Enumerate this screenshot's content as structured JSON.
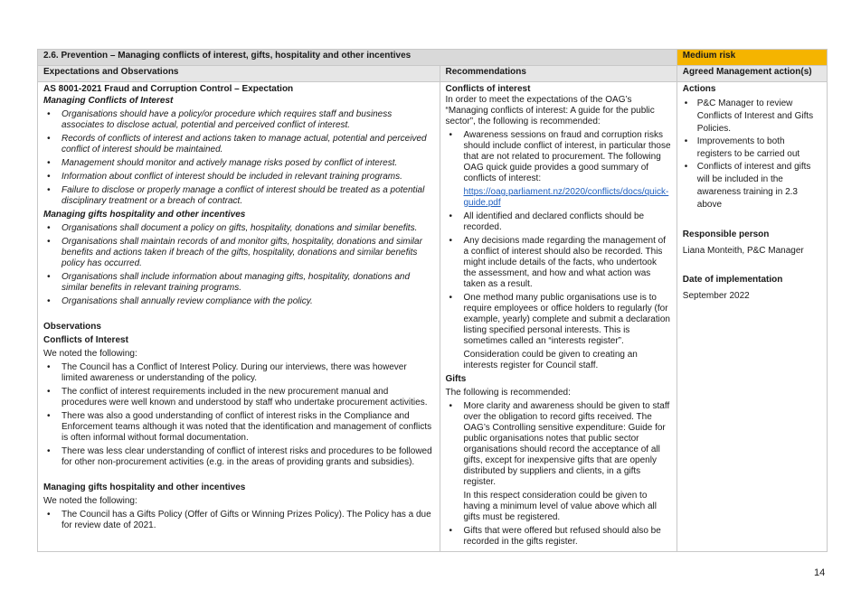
{
  "header": {
    "title": "2.6. Prevention – Managing conflicts of interest, gifts, hospitality and other incentives",
    "risk": "Medium risk",
    "col1": "Expectations and Observations",
    "col2": "Recommendations",
    "col3": "Agreed Management action(s)"
  },
  "col1": {
    "expectation_title": "AS 8001-2021 Fraud and Corruption Control – Expectation",
    "coi_heading": "Managing Conflicts of Interest",
    "coi_items": [
      "Organisations should have a policy/or procedure which requires staff and business associates to disclose actual, potential and perceived conflict of interest.",
      "Records of conflicts of interest and actions taken to manage actual, potential and perceived conflict of interest should be maintained.",
      "Management should monitor and actively manage risks posed by conflict of interest.",
      "Information about conflict of interest should be included in relevant training programs.",
      "Failure to disclose or properly manage a conflict of interest should be treated as a potential disciplinary treatment or a breach of contract."
    ],
    "gifts_heading": "Managing gifts hospitality and other incentives",
    "gifts_items": [
      "Organisations shall document a policy on gifts, hospitality, donations and similar benefits.",
      "Organisations shall maintain records of and monitor gifts, hospitality, donations and similar benefits and actions taken if breach of the gifts, hospitality, donations and similar benefits policy has occurred.",
      "Organisations shall include information about managing gifts, hospitality, donations and similar benefits in relevant training programs.",
      "Organisations shall annually review compliance with the policy."
    ],
    "observations_title": "Observations",
    "obs_coi_title": "Conflicts of Interest",
    "obs_coi_intro": "We noted the following:",
    "obs_coi_items": [
      "The Council has a Conflict of Interest Policy. During our interviews, there was however limited awareness or understanding of the policy.",
      "The conflict of interest requirements included in the new procurement manual and procedures were well known and understood by staff who undertake procurement activities.",
      "There was also a good understanding of conflict of interest risks in the Compliance and Enforcement teams although it was noted that the identification and management of conflicts is often informal without formal documentation.",
      "There was less clear understanding of conflict of interest risks and procedures to be followed for other non-procurement activities (e.g. in the areas of providing grants and subsidies)."
    ],
    "obs_gifts_title": "Managing gifts hospitality and other incentives",
    "obs_gifts_intro": "We noted the following:",
    "obs_gifts_items": [
      "The Council has a Gifts Policy (Offer of Gifts or Winning Prizes Policy). The Policy has a due for review date of 2021."
    ]
  },
  "col2": {
    "coi_title": "Conflicts of interest",
    "coi_intro": "In order to meet the expectations of the OAG’s “Managing conflicts of interest: A guide for the public sector”, the following is recommended:",
    "rec1": "Awareness sessions on fraud and corruption risks should include conflict of interest, in particular those that are not related to procurement. The following OAG quick guide provides a good summary of conflicts of interest:",
    "rec1_link": "https://oag.parliament.nz/2020/conflicts/docs/quick-guide.pdf",
    "rec2": "All identified and declared conflicts should be recorded.",
    "rec3": "Any decisions made regarding the management of a conflict of interest should also be recorded. This might include details of the facts, who undertook the assessment, and how and what action was taken as a result.",
    "rec4": "One method many public organisations use is to require employees or office holders to regularly (for example, yearly) complete and submit a declaration listing specified personal interests. This is sometimes called an “interests register”.",
    "rec4_extra": "Consideration could be given to creating an interests register for Council staff.",
    "gifts_title": "Gifts",
    "gifts_intro": "The following is recommended:",
    "gift1": "More clarity and awareness should be given to staff over the obligation to record gifts received. The OAG’s Controlling sensitive expenditure: Guide for public organisations notes that public sector organisations should record the acceptance of all gifts, except for inexpensive gifts that are openly distributed by suppliers and clients, in a gifts register.",
    "gift1_extra": "In this respect consideration could be given to having a minimum level of value above which all gifts must be registered.",
    "gift2": "Gifts that were offered but refused should also be recorded in the gifts register."
  },
  "col3": {
    "actions_title": "Actions",
    "actions": [
      "P&C Manager to review Conflicts of Interest and Gifts Policies.",
      "Improvements to both registers to be carried out",
      "Conflicts of interest and gifts will be included in the awareness training in 2.3 above"
    ],
    "responsible_title": "Responsible person",
    "responsible": "Liana Monteith, P&C Manager",
    "date_title": "Date of implementation",
    "date": "September 2022"
  },
  "page_number": "14"
}
